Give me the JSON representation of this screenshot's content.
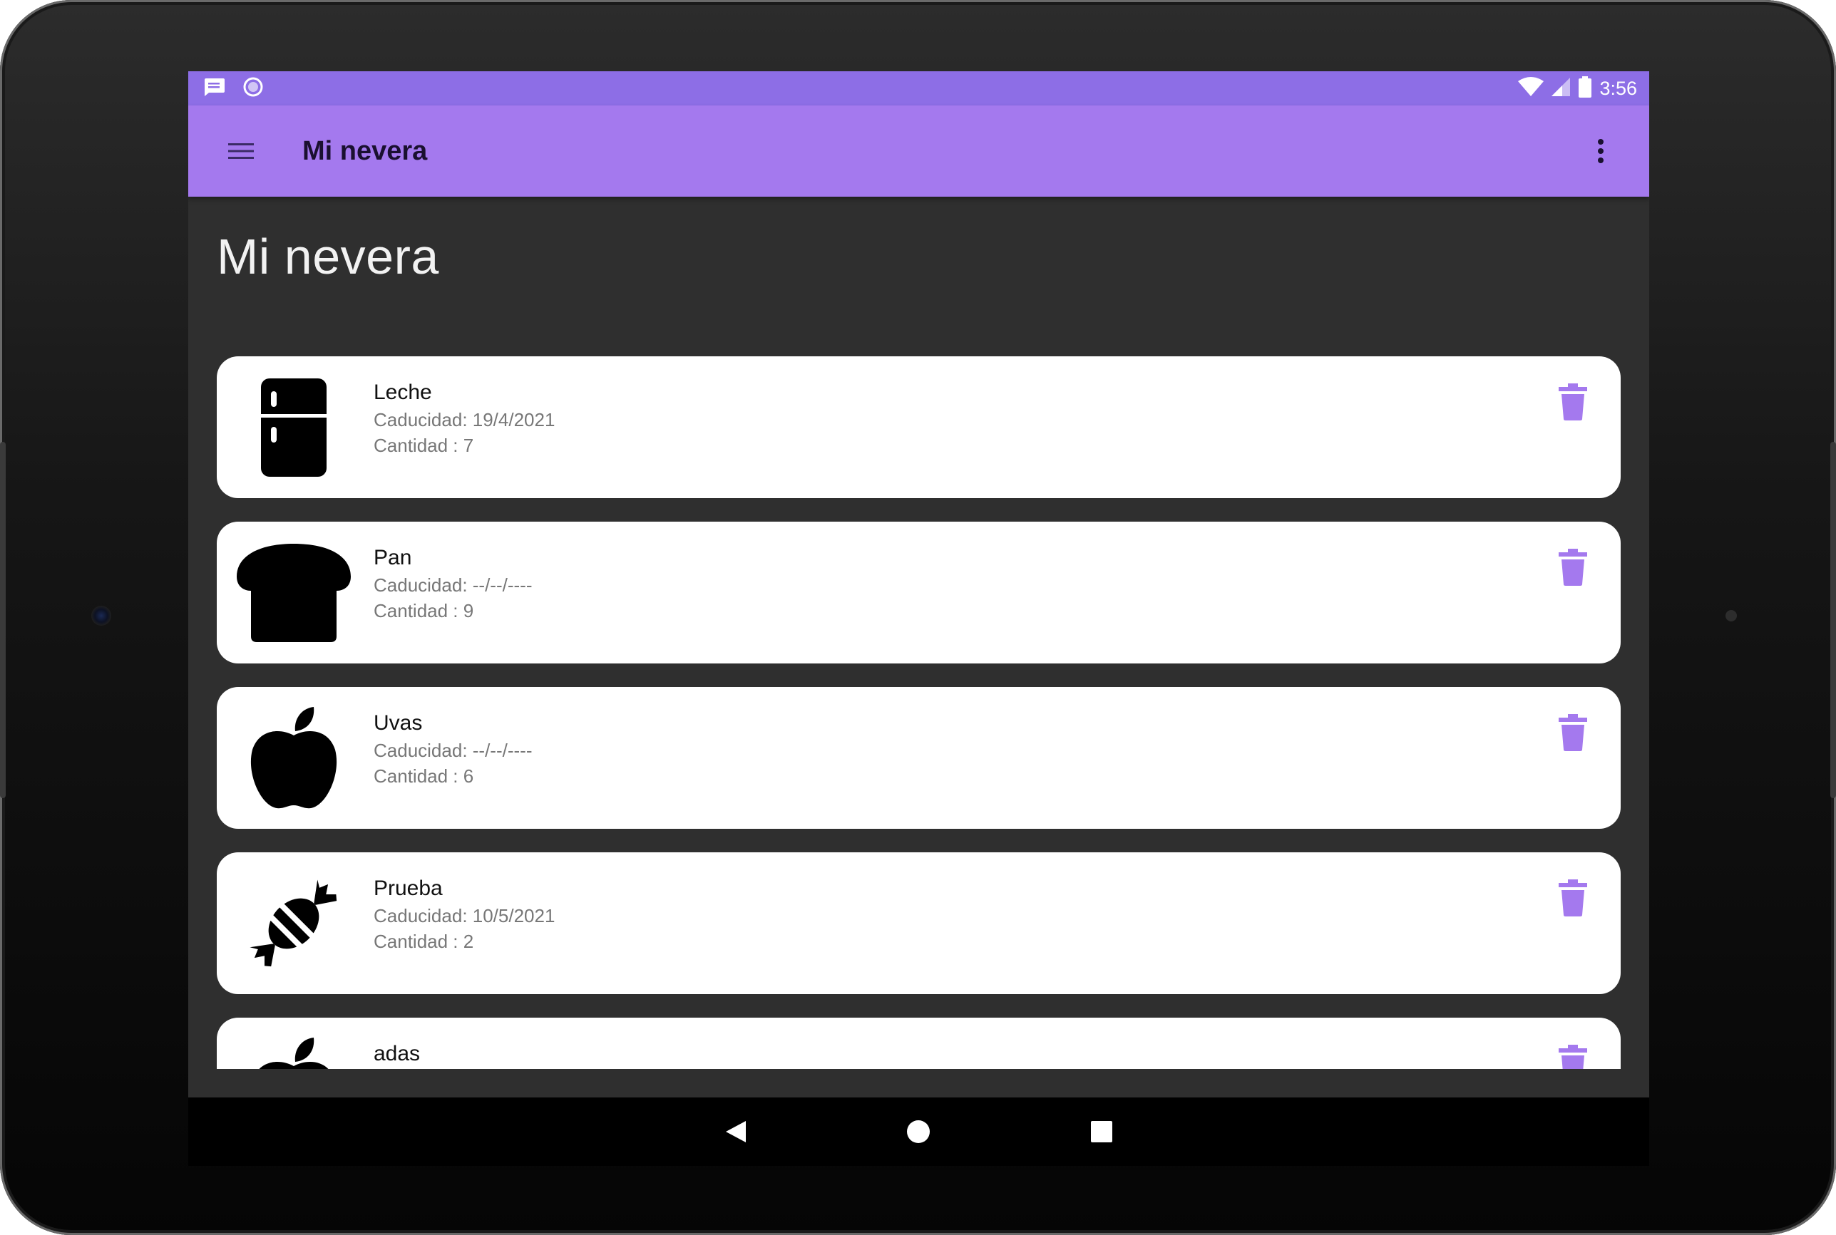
{
  "status_bar": {
    "time": "3:56",
    "icons": [
      "message-icon",
      "sync-circle-icon",
      "wifi-icon",
      "cell-signal-icon",
      "battery-icon"
    ]
  },
  "app_bar": {
    "title": "Mi nevera",
    "menu_icon": "hamburger-menu-icon",
    "overflow_icon": "more-vert-icon"
  },
  "page": {
    "heading": "Mi nevera"
  },
  "items": [
    {
      "name": "Leche",
      "expiry": "Caducidad: 19/4/2021",
      "quantity": "Cantidad : 7",
      "icon": "fridge-icon"
    },
    {
      "name": "Pan",
      "expiry": "Caducidad: --/--/----",
      "quantity": "Cantidad : 9",
      "icon": "bread-icon"
    },
    {
      "name": "Uvas",
      "expiry": "Caducidad: --/--/----",
      "quantity": "Cantidad : 6",
      "icon": "apple-icon"
    },
    {
      "name": "Prueba",
      "expiry": "Caducidad: 10/5/2021",
      "quantity": "Cantidad : 2",
      "icon": "candy-icon"
    },
    {
      "name": "adas",
      "icon": "apple-icon"
    }
  ],
  "colors": {
    "status_bar": "#8d6ee6",
    "app_bar": "#a479ee",
    "background": "#2f2f2f",
    "card": "#ffffff",
    "accent": "#a479ee"
  },
  "nav_bar": {
    "icons": [
      "back-icon",
      "home-icon",
      "recents-icon"
    ]
  }
}
